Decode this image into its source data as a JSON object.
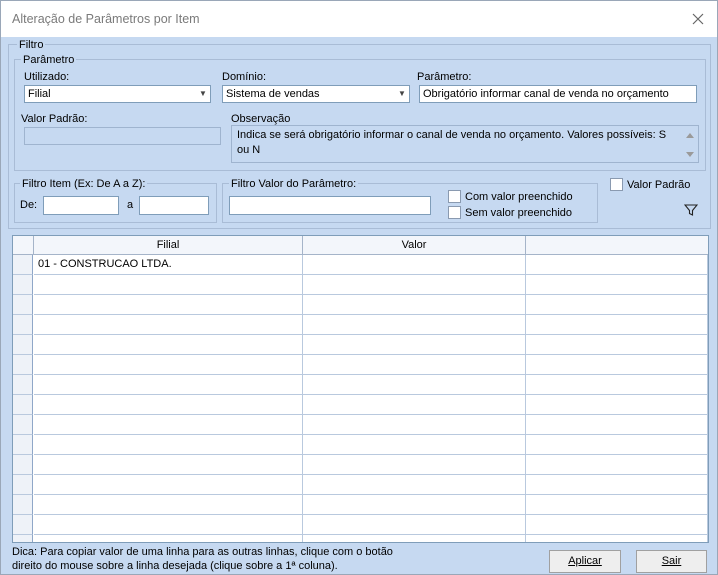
{
  "window": {
    "title": "Alteração de Parâmetros por Item"
  },
  "filtro": {
    "legend": "Filtro",
    "parametro_group": {
      "legend": "Parâmetro",
      "utilizado": {
        "label": "Utilizado:",
        "value": "Filial"
      },
      "dominio": {
        "label": "Domínio:",
        "value": "Sistema de vendas"
      },
      "parametro": {
        "label": "Parâmetro:",
        "value": "Obrigatório informar canal de venda no orçamento"
      },
      "valor_padrao": {
        "label": "Valor Padrão:",
        "value": ""
      },
      "observacao": {
        "label": "Observação",
        "text": "Indica se será obrigatório informar o canal de venda no orçamento. Valores possíveis: S ou N"
      }
    },
    "filtro_item": {
      "legend": "Filtro Item (Ex: De A a Z):",
      "de_label": "De:",
      "de_value": "",
      "a_label": "a",
      "a_value": ""
    },
    "filtro_valor": {
      "legend": "Filtro Valor do Parâmetro:",
      "value": "",
      "com_valor": "Com valor preenchido",
      "sem_valor": "Sem valor preenchido"
    },
    "valor_padrao_check": "Valor Padrão",
    "filter_icon": "funnel-icon"
  },
  "grid": {
    "columns": [
      "Filial",
      "Valor",
      ""
    ],
    "rows": [
      [
        "01 - CONSTRUCAO LTDA.",
        "",
        ""
      ],
      [
        "",
        "",
        ""
      ],
      [
        "",
        "",
        ""
      ],
      [
        "",
        "",
        ""
      ],
      [
        "",
        "",
        ""
      ],
      [
        "",
        "",
        ""
      ],
      [
        "",
        "",
        ""
      ],
      [
        "",
        "",
        ""
      ],
      [
        "",
        "",
        ""
      ],
      [
        "",
        "",
        ""
      ],
      [
        "",
        "",
        ""
      ],
      [
        "",
        "",
        ""
      ],
      [
        "",
        "",
        ""
      ],
      [
        "",
        "",
        ""
      ],
      [
        "",
        "",
        ""
      ]
    ]
  },
  "footer": {
    "hint_line1": "Dica: Para copiar valor de uma linha para as outras linhas, clique com o botão",
    "hint_line2": "direito do mouse sobre a linha desejada (clique sobre a 1ª coluna).",
    "apply_label": "Aplicar",
    "exit_label": "Sair"
  }
}
